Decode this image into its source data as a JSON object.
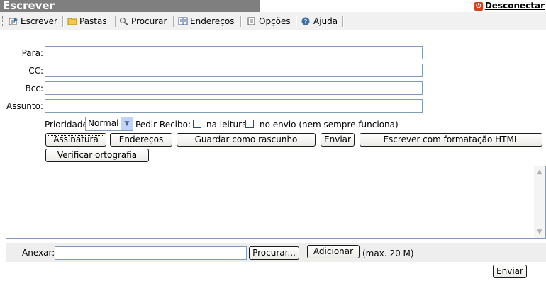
{
  "header": {
    "title": "Escrever",
    "logout_label": "Desconectar"
  },
  "menu": {
    "items": [
      {
        "label": "Escrever",
        "icon": "compose-icon"
      },
      {
        "label": "Pastas",
        "icon": "folder-icon"
      },
      {
        "label": "Procurar",
        "icon": "search-icon"
      },
      {
        "label": "Endereços",
        "icon": "address-book-icon"
      },
      {
        "label": "Opções",
        "icon": "options-icon"
      },
      {
        "label": "Ajuda",
        "icon": "help-icon"
      }
    ]
  },
  "form": {
    "to_label": "Para:",
    "to_value": "",
    "cc_label": "CC:",
    "cc_value": "",
    "bcc_label": "Bcc:",
    "bcc_value": "",
    "subject_label": "Assunto:",
    "subject_value": "",
    "priority_label": "Prioridade",
    "priority_value": "Normal",
    "receipt_label": "Pedir Recibo:",
    "on_read_label": "na leitura",
    "on_read_checked": false,
    "on_delivery_label": "no envio (nem sempre funciona)",
    "on_delivery_checked": false
  },
  "buttons": {
    "signature": "Assinatura",
    "addresses": "Endereços",
    "save_draft": "Guardar como rascunho",
    "send": "Enviar",
    "html_compose": "Escrever com formatação HTML",
    "spellcheck": "Verificar ortografia",
    "send_bottom": "Enviar"
  },
  "body": {
    "value": ""
  },
  "attach": {
    "label": "Anexar:",
    "value": "",
    "browse": "Procurar...",
    "add": "Adicionar",
    "max_note": "(max. 20 M)"
  }
}
